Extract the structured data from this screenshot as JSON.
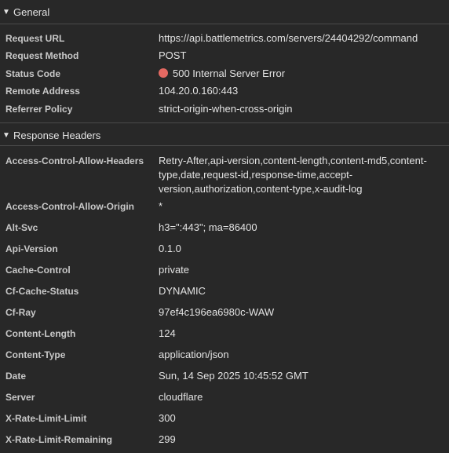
{
  "general": {
    "title": "General",
    "rows": [
      {
        "key": "Request URL",
        "value": "https://api.battlemetrics.com/servers/24404292/command"
      },
      {
        "key": "Request Method",
        "value": "POST"
      },
      {
        "key": "Status Code",
        "value": "500 Internal Server Error",
        "status_color": "#e46962"
      },
      {
        "key": "Remote Address",
        "value": "104.20.0.160:443"
      },
      {
        "key": "Referrer Policy",
        "value": "strict-origin-when-cross-origin"
      }
    ]
  },
  "response_headers": {
    "title": "Response Headers",
    "rows": [
      {
        "key": "Access-Control-Allow-Headers",
        "value": "Retry-After,api-version,content-length,content-md5,content-type,date,request-id,response-time,accept-version,authorization,content-type,x-audit-log"
      },
      {
        "key": "Access-Control-Allow-Origin",
        "value": "*"
      },
      {
        "key": "Alt-Svc",
        "value": "h3=\":443\"; ma=86400"
      },
      {
        "key": "Api-Version",
        "value": "0.1.0"
      },
      {
        "key": "Cache-Control",
        "value": "private"
      },
      {
        "key": "Cf-Cache-Status",
        "value": "DYNAMIC"
      },
      {
        "key": "Cf-Ray",
        "value": "97ef4c196ea6980c-WAW"
      },
      {
        "key": "Content-Length",
        "value": "124"
      },
      {
        "key": "Content-Type",
        "value": "application/json"
      },
      {
        "key": "Date",
        "value": "Sun, 14 Sep 2025 10:45:52 GMT"
      },
      {
        "key": "Server",
        "value": "cloudflare"
      },
      {
        "key": "X-Rate-Limit-Limit",
        "value": "300"
      },
      {
        "key": "X-Rate-Limit-Remaining",
        "value": "299"
      }
    ]
  },
  "icons": {
    "expanded": "triangle-down-icon",
    "status": "status-dot-icon"
  }
}
